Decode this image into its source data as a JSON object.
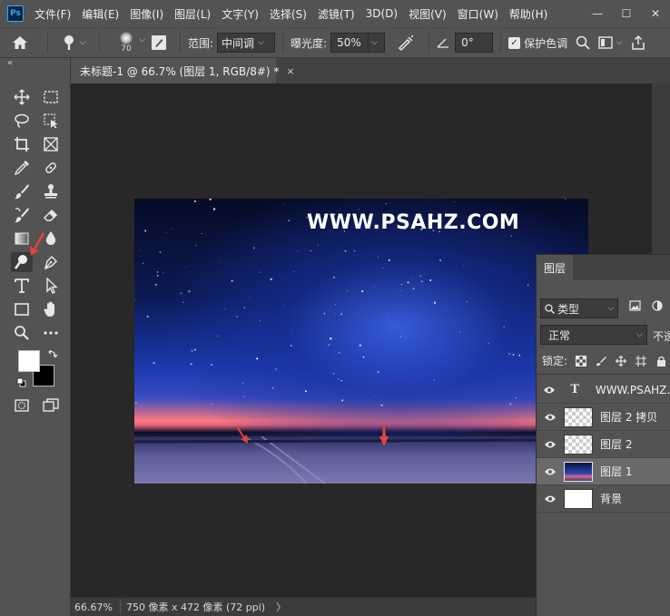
{
  "app": {
    "logo_text": "Ps"
  },
  "menu": [
    "文件(F)",
    "编辑(E)",
    "图像(I)",
    "图层(L)",
    "文字(Y)",
    "选择(S)",
    "滤镜(T)",
    "3D(D)",
    "视图(V)",
    "窗口(W)",
    "帮助(H)"
  ],
  "window_controls": {
    "minimize": "—",
    "maximize": "☐",
    "close": "✕"
  },
  "options_bar": {
    "brush_size": "70",
    "range_label": "范围:",
    "range_value": "中间调",
    "exposure_label": "曝光度:",
    "exposure_value": "50%",
    "angle_value": "0°",
    "protect_tones_label": "保护色调",
    "protect_tones_checked": true
  },
  "document": {
    "tab_title": "未标题-1 @ 66.7% (图层 1, RGB/8#) *",
    "tab_close": "×",
    "watermark": "WWW.PSAHZ.COM"
  },
  "status_bar": {
    "zoom": "66.67%",
    "doc_info": "750 像素 x 472 像素 (72 ppi)",
    "arrow": "〉"
  },
  "colors": {
    "foreground": "#ffffff",
    "background": "#000000",
    "accent_arrow": "#e8443a"
  },
  "tools": [
    "move-tool",
    "marquee-tool",
    "lasso-tool",
    "object-select-tool",
    "crop-tool",
    "frame-tool",
    "eyedropper-tool",
    "healing-brush-tool",
    "brush-tool",
    "clone-stamp-tool",
    "history-brush-tool",
    "eraser-tool",
    "gradient-tool",
    "blur-tool",
    "dodge-tool",
    "pen-tool",
    "type-tool",
    "path-selection-tool",
    "rectangle-tool",
    "hand-tool",
    "zoom-tool",
    "more-tools"
  ],
  "layers_panel": {
    "tab": "图层",
    "filter_kind": "类型",
    "blend_mode": "正常",
    "opacity_label": "不透",
    "lock_label": "锁定:",
    "layers": [
      {
        "name": "WWW.PSAHZ.C",
        "type": "text",
        "visible": true,
        "selected": false
      },
      {
        "name": "图层 2 拷贝",
        "type": "pixel",
        "visible": true,
        "selected": false
      },
      {
        "name": "图层 2",
        "type": "pixel",
        "visible": true,
        "selected": false
      },
      {
        "name": "图层 1",
        "type": "image",
        "visible": true,
        "selected": true
      },
      {
        "name": "背景",
        "type": "background",
        "visible": true,
        "selected": false
      }
    ],
    "text_layer_glyph": "T"
  }
}
